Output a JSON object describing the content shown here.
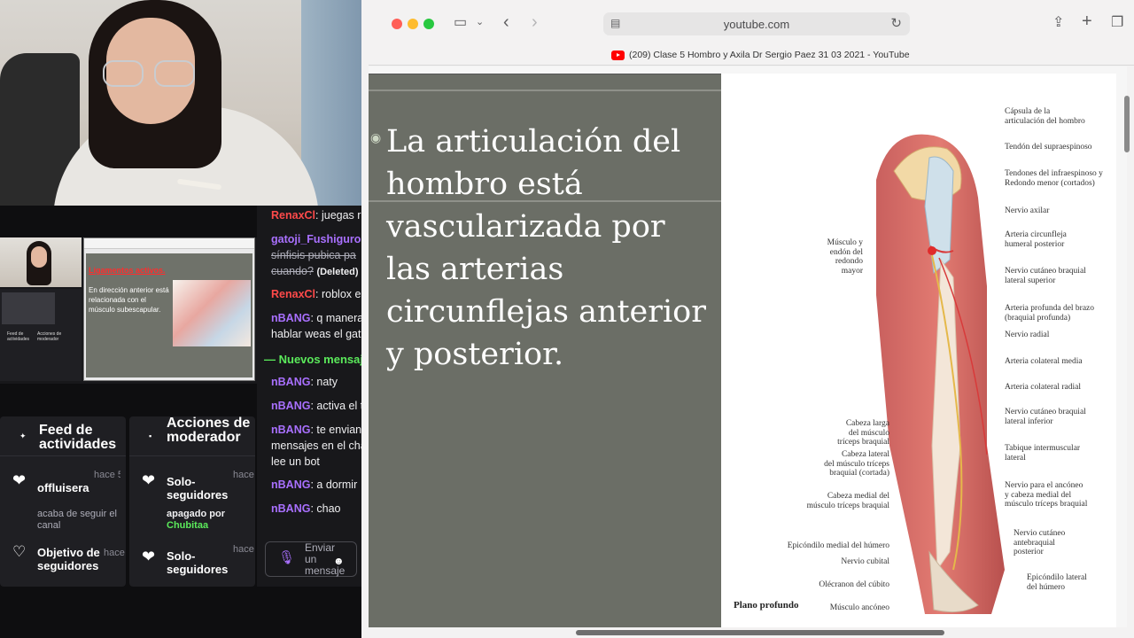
{
  "chat": {
    "messages": [
      {
        "user": "RenaxCl",
        "text": ": juegas robl",
        "color": "#ff4a4a"
      },
      {
        "user": "gatoji_Fushiguro",
        "text": ": y",
        "color": "#a970ff"
      },
      {
        "deleted_text": "sínfisis pubica pa cuando?",
        "deleted_label": "(Deleted)"
      },
      {
        "user": "RenaxCl",
        "text": ": roblox es",
        "color": "#ff4a4a"
      },
      {
        "user": "nBANG",
        "text": ": q manera de hablar weas el gatoj",
        "color": "#a970ff"
      },
      {
        "user": "nBANG",
        "text": ": naty",
        "color": "#a970ff"
      },
      {
        "user": "nBANG",
        "text": ": activa el tts",
        "color": "#a970ff"
      },
      {
        "user": "nBANG",
        "text": ": te envian mensajes en el chat lee un bot",
        "color": "#a970ff"
      },
      {
        "user": "nBANG",
        "text": ": a dormir",
        "color": "#a970ff"
      },
      {
        "user": "nBANG",
        "text": ": chao",
        "color": "#a970ff"
      }
    ],
    "new_messages_label": "— Nuevos mensajes",
    "input_placeholder": "Enviar un mensaje",
    "cut_char": "c"
  },
  "feed": {
    "title": "Feed de actividades",
    "items": [
      {
        "name": "offluisera",
        "sub": "acaba de seguir el canal",
        "time": "hace 5 horas"
      },
      {
        "name": "Objetivo de seguidores",
        "time": "hace"
      }
    ]
  },
  "moderator": {
    "title": "Acciones de moderador",
    "items": [
      {
        "name": "Solo-seguidores",
        "sub_prefix": "apagado por",
        "sub_user": "Chubitaa",
        "time": "hace"
      },
      {
        "name": "Solo-seguidores",
        "time": "hace"
      }
    ]
  },
  "mini_dashboard": {
    "slide_title": "Ligamentos activos.",
    "slide_text": "En dirección anterior está relacionada con el músculo subescapular.",
    "feed_label": "Feed de actividades",
    "mod_label": "Acciones de moderador"
  },
  "browser": {
    "url": "youtube.com",
    "tab_title": "(209) Clase 5 Hombro y Axila Dr Sergio Paez 31 03 2021 - YouTube"
  },
  "video": {
    "slide_text": "La articulación del hombro está vascularizada por las arterias circunflejas anterior y posterior.",
    "plane_label": "Plano profundo",
    "labels_right": [
      "Cápsula de la\narticulación del hombro",
      "Tendón del supraespinoso",
      "Tendones del infraespinoso y\nRedondo menor (cortados)",
      "Nervio axilar",
      "Arteria circunfleja\nhumeral posterior",
      "Nervio cutáneo braquial\nlateral superior",
      "Arteria profunda del brazo\n(braquial profunda)",
      "Nervio radial",
      "Arteria colateral media",
      "Arteria colateral radial",
      "Nervio cutáneo braquial\nlateral inferior",
      "Tabique intermuscular\nlateral",
      "Nervio para el ancóneo\ny cabeza medial del\nmúsculo tríceps braquial",
      "Nervio cutáneo\nantebraquial\nposterior",
      "Epicóndilo lateral\ndel húmero"
    ],
    "labels_left": [
      "Músculo y\nendón del\nredondo\nmayor",
      "Cabeza larga\ndel músculo\ntríceps braquial",
      "Cabeza lateral\ndel músculo tríceps\nbraquial (cortada)",
      "Cabeza medial del\nmúsculo tríceps braquial",
      "Epicóndilo medial del húmero",
      "Nervio cubital",
      "Olécranon del cúbito",
      "Músculo ancóneo"
    ]
  }
}
